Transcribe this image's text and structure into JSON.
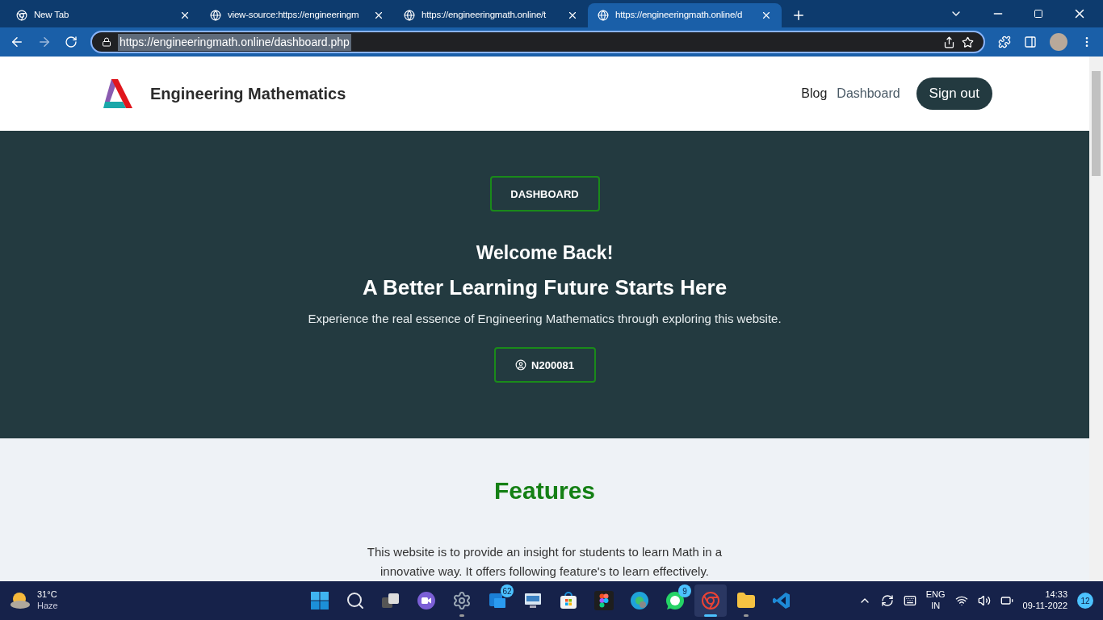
{
  "browser": {
    "tabs": [
      {
        "title": "New Tab",
        "kind": "chrome",
        "selected": false
      },
      {
        "title": "view-source:https://engineeringm",
        "kind": "globe",
        "selected": false
      },
      {
        "title": "https://engineeringmath.online/t",
        "kind": "globe",
        "selected": false
      },
      {
        "title": "https://engineeringmath.online/d",
        "kind": "globe",
        "selected": true
      }
    ],
    "address": "https://engineeringmath.online/dashboard.php"
  },
  "site": {
    "brand": "Engineering Mathematics",
    "nav": [
      {
        "label": "Blog",
        "selected": false
      },
      {
        "label": "Dashboard",
        "selected": true
      }
    ],
    "sign_out": "Sign out"
  },
  "hero": {
    "badge": "DASHBOARD",
    "welcome": "Welcome Back!",
    "headline": "A Better Learning Future Starts Here",
    "subtitle": "Experience the real essence of Engineering Mathematics through exploring this website.",
    "user": "N200081"
  },
  "features": {
    "title": "Features",
    "text": "This website is to provide an insight for students to learn Math in a innovative way. It offers following feature's to learn effectively."
  },
  "taskbar": {
    "weather": {
      "temp": "31°C",
      "condition": "Haze"
    },
    "apps": [
      {
        "kind": "start",
        "running": false,
        "active": false
      },
      {
        "kind": "search",
        "running": false,
        "active": false
      },
      {
        "kind": "taskview",
        "running": false,
        "active": false
      },
      {
        "kind": "chat",
        "running": false,
        "active": false
      },
      {
        "kind": "settings",
        "running": true,
        "active": false
      },
      {
        "kind": "mail",
        "badge": "62",
        "running": false,
        "active": false
      },
      {
        "kind": "remote",
        "running": false,
        "active": false
      },
      {
        "kind": "store",
        "running": false,
        "active": false
      },
      {
        "kind": "figma",
        "running": false,
        "active": false
      },
      {
        "kind": "edge",
        "running": false,
        "active": false
      },
      {
        "kind": "whatsapp",
        "badge": "9",
        "running": false,
        "active": false
      },
      {
        "kind": "chrome",
        "running": true,
        "active": true
      },
      {
        "kind": "explorer",
        "running": true,
        "active": false
      },
      {
        "kind": "vscode",
        "running": false,
        "active": false
      }
    ],
    "language": "ENG",
    "region": "IN",
    "time": "14:33",
    "date": "09-11-2022",
    "notifications": "12"
  }
}
